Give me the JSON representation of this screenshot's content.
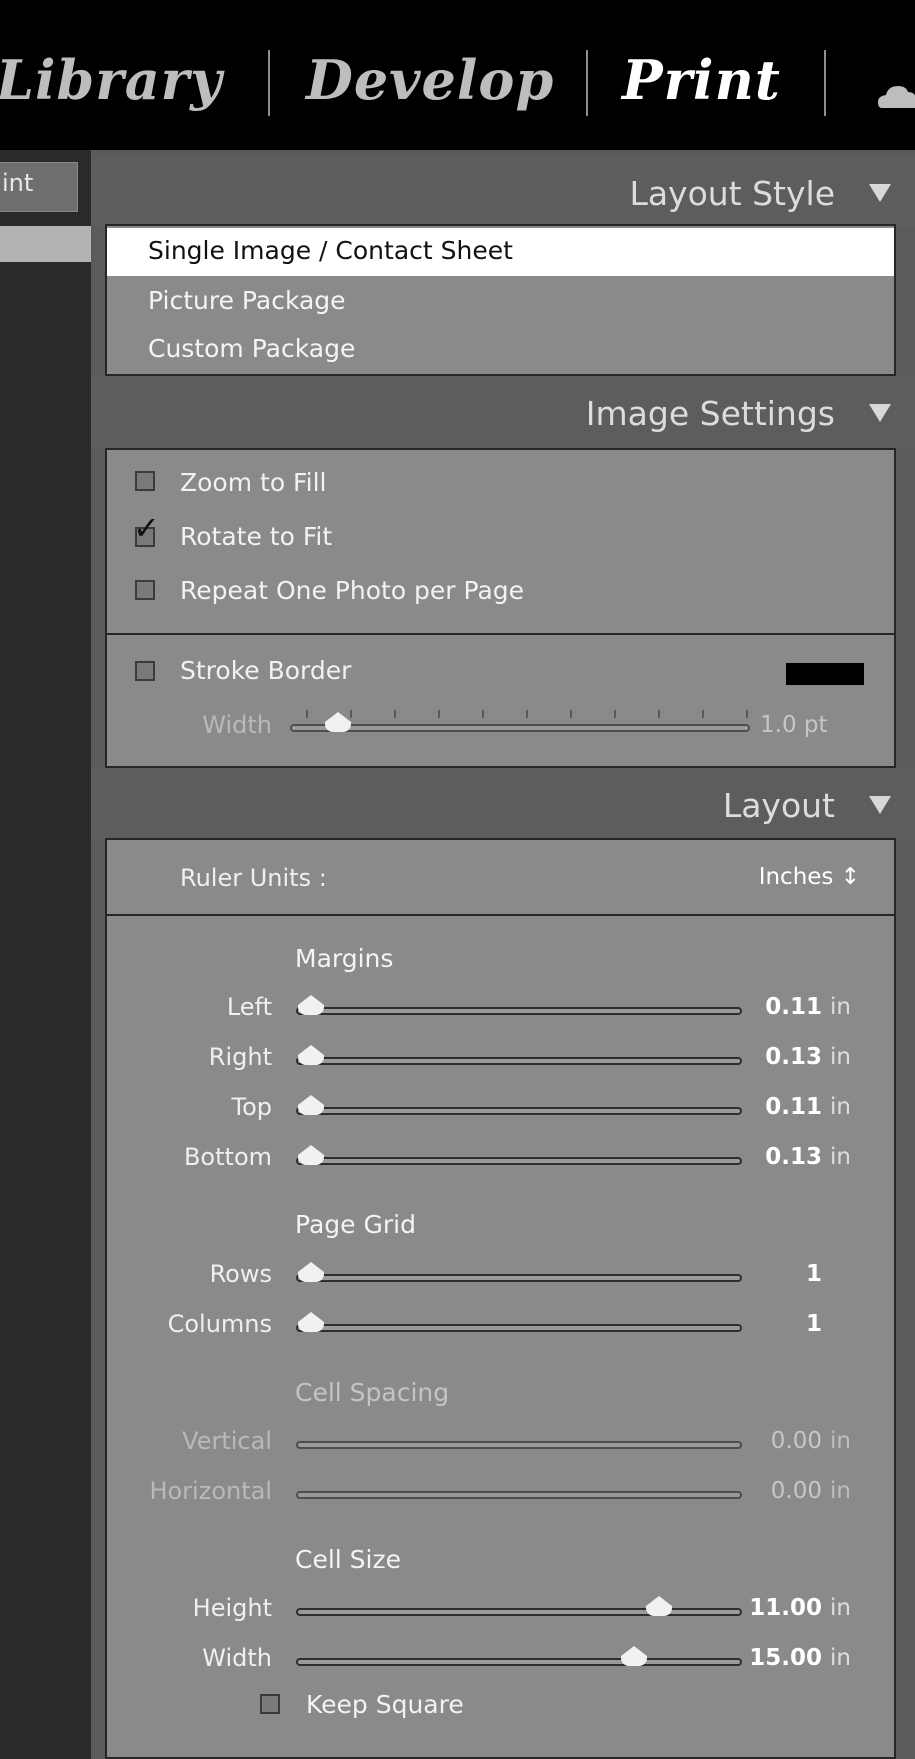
{
  "modules": [
    "Library",
    "Develop",
    "Print"
  ],
  "left_tab_label": "int",
  "layout_style": {
    "title": "Layout Style",
    "options": [
      "Single Image / Contact Sheet",
      "Picture Package",
      "Custom Package"
    ],
    "selected": "Single Image / Contact Sheet"
  },
  "image_settings": {
    "title": "Image Settings",
    "zoom_to_fill": {
      "label": "Zoom to Fill",
      "checked": false
    },
    "rotate_to_fit": {
      "label": "Rotate to Fit",
      "checked": true
    },
    "repeat_one_photo": {
      "label": "Repeat One Photo per Page",
      "checked": false
    },
    "stroke_border": {
      "label": "Stroke Border",
      "checked": false,
      "color": "#000000"
    },
    "width": {
      "label": "Width",
      "value": "1.0 pt",
      "fraction": 0.06
    }
  },
  "layout": {
    "title": "Layout",
    "ruler_units_label": "Ruler Units :",
    "ruler_units_value": "Inches ↕",
    "margins_title": "Margins",
    "margins": [
      {
        "label": "Left",
        "value": "0.11",
        "unit": "in",
        "fraction": 0.0
      },
      {
        "label": "Right",
        "value": "0.13",
        "unit": "in",
        "fraction": 0.0
      },
      {
        "label": "Top",
        "value": "0.11",
        "unit": "in",
        "fraction": 0.0
      },
      {
        "label": "Bottom",
        "value": "0.13",
        "unit": "in",
        "fraction": 0.0
      }
    ],
    "page_grid_title": "Page Grid",
    "page_grid": [
      {
        "label": "Rows",
        "value": "1",
        "fraction": 0.0
      },
      {
        "label": "Columns",
        "value": "1",
        "fraction": 0.0
      }
    ],
    "cell_spacing_title": "Cell Spacing",
    "cell_spacing": [
      {
        "label": "Vertical",
        "value": "0.00",
        "unit": "in"
      },
      {
        "label": "Horizontal",
        "value": "0.00",
        "unit": "in"
      }
    ],
    "cell_size_title": "Cell Size",
    "cell_size": [
      {
        "label": "Height",
        "value": "11.00",
        "unit": "in",
        "fraction": 0.84
      },
      {
        "label": "Width",
        "value": "15.00",
        "unit": "in",
        "fraction": 0.78
      }
    ],
    "keep_square": {
      "label": "Keep Square",
      "checked": false
    }
  }
}
